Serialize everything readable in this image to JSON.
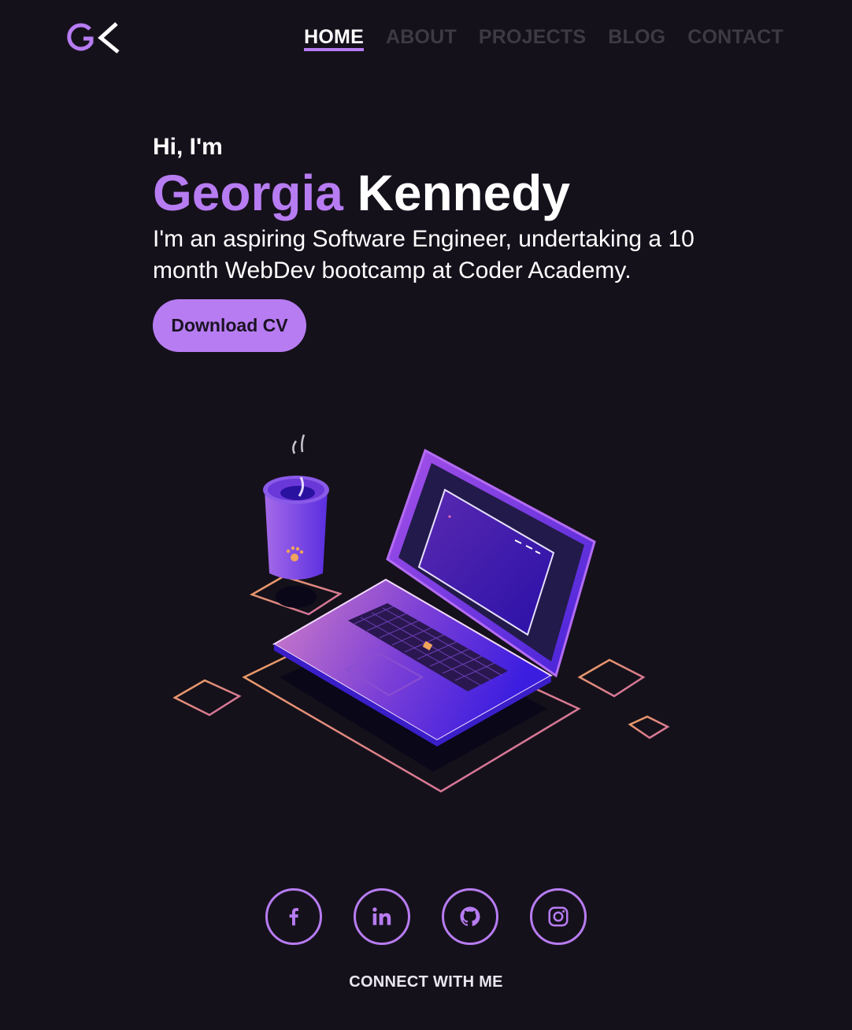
{
  "brand": {
    "logo_text": "GK",
    "accent_color": "#b77cf2",
    "background_color": "#15111b"
  },
  "nav": {
    "items": [
      {
        "label": "HOME",
        "active": true
      },
      {
        "label": "ABOUT",
        "active": false
      },
      {
        "label": "PROJECTS",
        "active": false
      },
      {
        "label": "BLOG",
        "active": false
      },
      {
        "label": "CONTACT",
        "active": false
      }
    ]
  },
  "hero": {
    "greeting": "Hi, I'm",
    "first_name": "Georgia",
    "last_name": "Kennedy",
    "tagline": "I'm an aspiring Software Engineer, undertaking a 10 month WebDev bootcamp at Coder Academy.",
    "cv_button": "Download CV",
    "illustration": "isometric-laptop-and-coffee-cup"
  },
  "socials": {
    "items": [
      {
        "name": "facebook",
        "icon": "facebook-icon"
      },
      {
        "name": "linkedin",
        "icon": "linkedin-icon"
      },
      {
        "name": "github",
        "icon": "github-icon"
      },
      {
        "name": "instagram",
        "icon": "instagram-icon"
      }
    ],
    "caption": "CONNECT WITH ME"
  }
}
